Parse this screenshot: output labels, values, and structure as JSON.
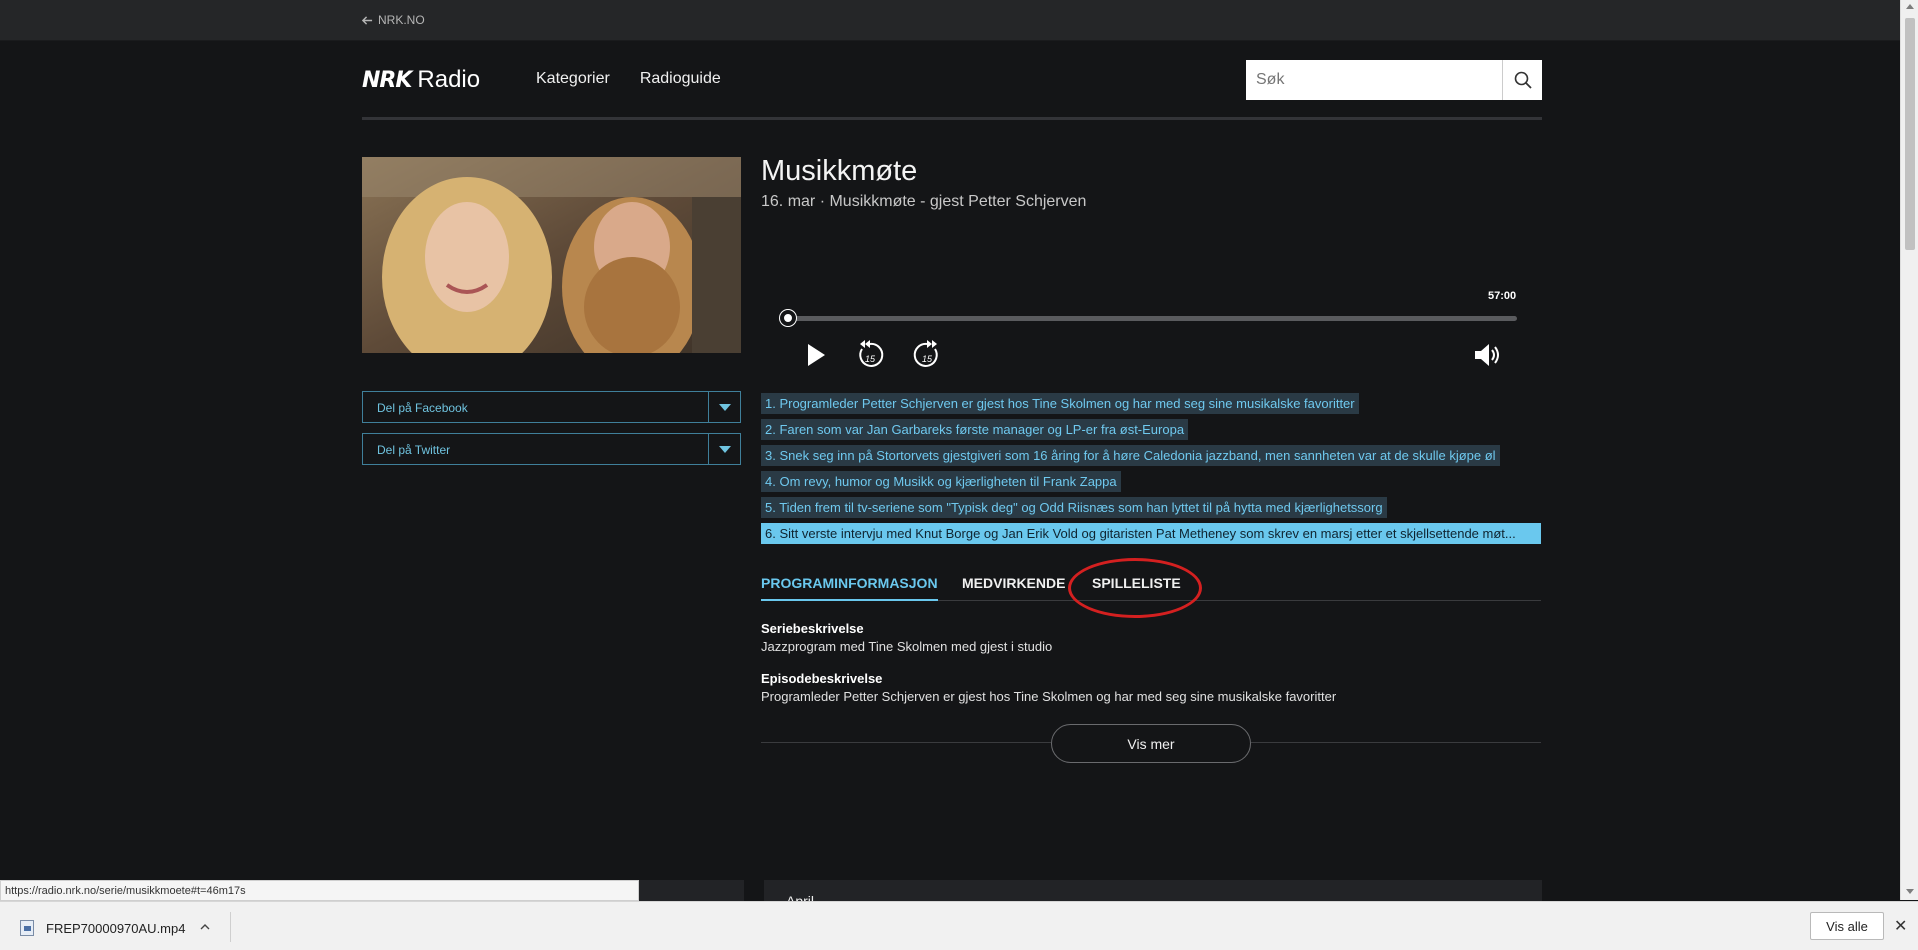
{
  "topbar": {
    "back_label": "NRK.NO"
  },
  "header": {
    "logo_nrk": "NRK",
    "logo_radio": "Radio",
    "nav": [
      "Kategorier",
      "Radioguide"
    ],
    "search_placeholder": "Søk"
  },
  "share": {
    "facebook": "Del på Facebook",
    "twitter": "Del på Twitter"
  },
  "episode": {
    "title": "Musikkmøte",
    "subtitle": "16. mar · Musikkmøte - gjest Petter Schjerven"
  },
  "player": {
    "duration": "57:00",
    "progress": 0.0,
    "skip_back_label": "15",
    "skip_forward_label": "15"
  },
  "chapters": [
    "1. Programleder Petter Schjerven er gjest hos Tine Skolmen og har med seg sine musikalske favoritter",
    "2. Faren som var Jan Garbareks første manager og LP-er fra øst-Europa",
    "3. Snek seg inn på Stortorvets gjestgiveri som 16 åring for å høre Caledonia jazzband, men sannheten var at de skulle kjøpe øl",
    "4. Om revy, humor og Musikk og kjærligheten til Frank Zappa",
    "5. Tiden frem til tv-seriene som \"Typisk deg\" og Odd Riisnæs som han lyttet til på hytta med kjærlighetssorg",
    "6. Sitt verste intervju med Knut Borge og Jan Erik Vold og gitaristen Pat Metheney som skrev en marsj etter et skjellsettende møt..."
  ],
  "tabs": [
    "PROGRAMINFORMASJON",
    "MEDVIRKENDE",
    "SPILLELISTE"
  ],
  "info": {
    "series_heading": "Seriebeskrivelse",
    "series_text": "Jazzprogram med Tine Skolmen med gjest i studio",
    "episode_heading": "Episodebeskrivelse",
    "episode_text": "Programleder Petter Schjerven er gjest hos Tine Skolmen og har med seg sine musikalske favoritter",
    "more_button": "Vis mer"
  },
  "lower": {
    "month": "April"
  },
  "status_url": "https://radio.nrk.no/serie/musikkmoete#t=46m17s",
  "download_bar": {
    "filename": "FREP70000970AU.mp4",
    "show_all": "Vis alle",
    "close": "✕"
  },
  "colors": {
    "background": "#141517",
    "accent": "#6ac8ee",
    "annotation_circle": "#d42020"
  }
}
